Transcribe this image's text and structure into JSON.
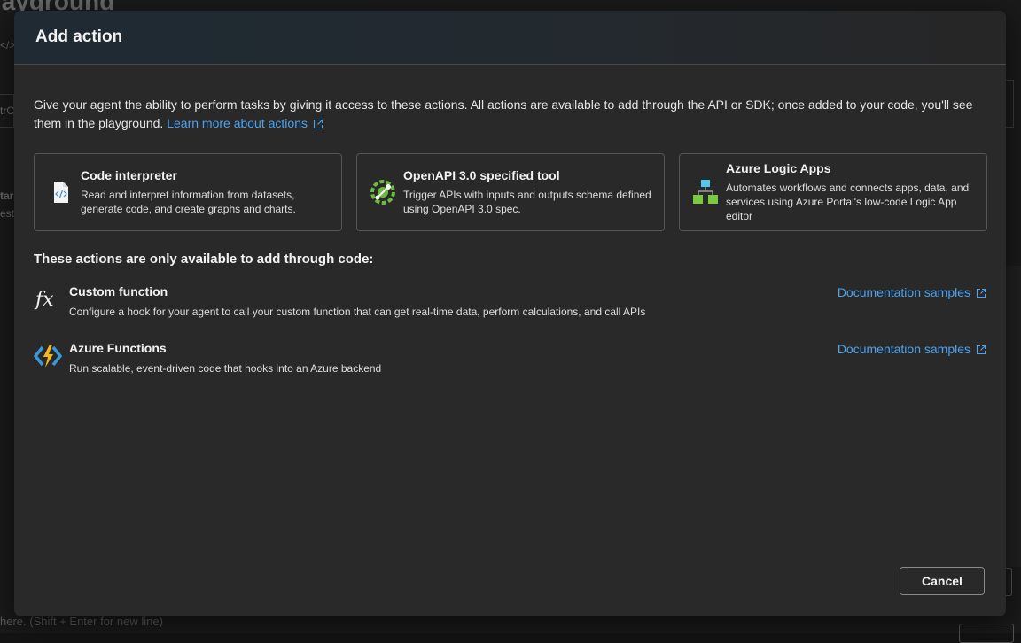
{
  "background": {
    "title_fragment": "layground",
    "code_fragment": "</>",
    "field_fragment": "trC",
    "label_fragment_1": "tar",
    "label_fragment_2": "est",
    "chat_placeholder": "here. (Shift + Enter for new line)"
  },
  "dialog": {
    "title": "Add action",
    "intro_text": "Give your agent the ability to perform tasks by giving it access to these actions. All actions are available to add through the API or SDK; once added to your code, you'll see them in the playground.",
    "learn_more_link": "Learn more about actions",
    "cards": [
      {
        "icon": "code-file-icon",
        "title": "Code interpreter",
        "description": "Read and interpret information from datasets, generate code, and create graphs and charts."
      },
      {
        "icon": "openapi-icon",
        "title": "OpenAPI 3.0 specified tool",
        "description": "Trigger APIs with inputs and outputs schema defined using OpenAPI 3.0 spec."
      },
      {
        "icon": "logic-apps-icon",
        "title": "Azure Logic Apps",
        "description": "Automates workflows and connects apps, data, and services using Azure Portal's low-code Logic App editor"
      }
    ],
    "code_only_title": "These actions are only available to add through code:",
    "code_only_items": [
      {
        "icon": "function-fx-icon",
        "title": "Custom function",
        "description": "Configure a hook for your agent to call your custom function that can get real-time data, perform calculations, and call APIs",
        "link": "Documentation samples"
      },
      {
        "icon": "azure-functions-icon",
        "title": "Azure Functions",
        "description": "Run scalable, event-driven code that hooks into an Azure backend",
        "link": "Documentation samples"
      }
    ],
    "cancel_label": "Cancel"
  },
  "colors": {
    "accent_link": "#4ba3ef",
    "dialog_bg": "#292929",
    "backdrop": "#141414"
  }
}
